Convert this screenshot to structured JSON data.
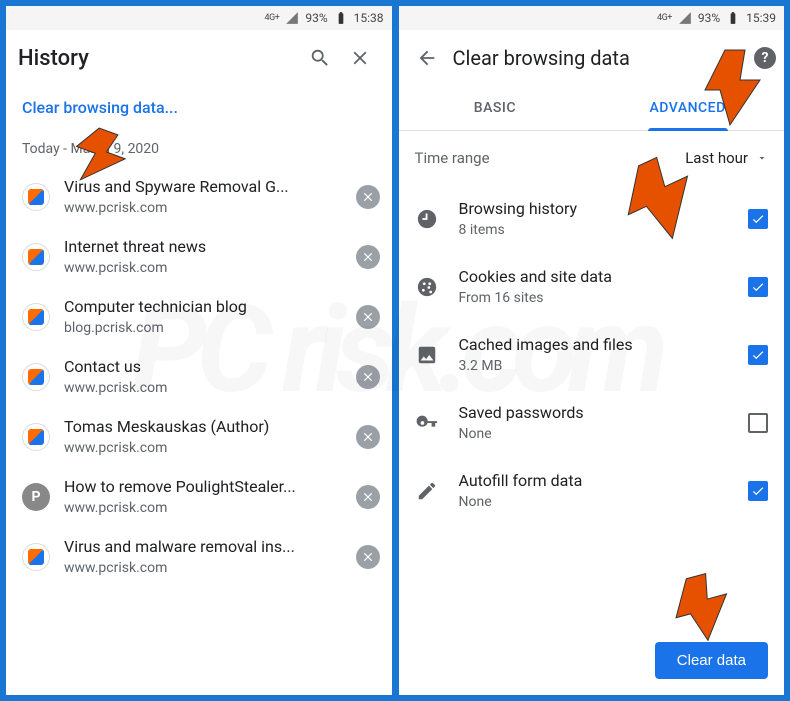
{
  "left": {
    "status": {
      "net": "4G+",
      "battery": "93%",
      "time": "15:38"
    },
    "title": "History",
    "clear_link": "Clear browsing data...",
    "date_header": "Today - March 9, 2020",
    "items": [
      {
        "title": "Virus and Spyware Removal G...",
        "url": "www.pcrisk.com",
        "fav": "pc"
      },
      {
        "title": "Internet threat news",
        "url": "www.pcrisk.com",
        "fav": "pc"
      },
      {
        "title": "Computer technician blog",
        "url": "blog.pcrisk.com",
        "fav": "pc"
      },
      {
        "title": "Contact us",
        "url": "www.pcrisk.com",
        "fav": "pc"
      },
      {
        "title": "Tomas Meskauskas (Author)",
        "url": "www.pcrisk.com",
        "fav": "pc"
      },
      {
        "title": "How to remove PoulightStealer...",
        "url": "www.pcrisk.com",
        "fav": "p"
      },
      {
        "title": "Virus and malware removal ins...",
        "url": "www.pcrisk.com",
        "fav": "pc"
      }
    ]
  },
  "right": {
    "status": {
      "net": "4G+",
      "battery": "93%",
      "time": "15:39"
    },
    "title": "Clear browsing data",
    "tabs": {
      "basic": "BASIC",
      "advanced": "ADVANCED"
    },
    "timerange": {
      "label": "Time range",
      "value": "Last hour"
    },
    "items": [
      {
        "icon": "clock",
        "title": "Browsing history",
        "sub": "8 items",
        "checked": true
      },
      {
        "icon": "cookie",
        "title": "Cookies and site data",
        "sub": "From 16 sites",
        "checked": true
      },
      {
        "icon": "image",
        "title": "Cached images and files",
        "sub": "3.2 MB",
        "checked": true
      },
      {
        "icon": "key",
        "title": "Saved passwords",
        "sub": "None",
        "checked": false
      },
      {
        "icon": "pencil",
        "title": "Autofill form data",
        "sub": "None",
        "checked": true
      }
    ],
    "button": "Clear data"
  }
}
